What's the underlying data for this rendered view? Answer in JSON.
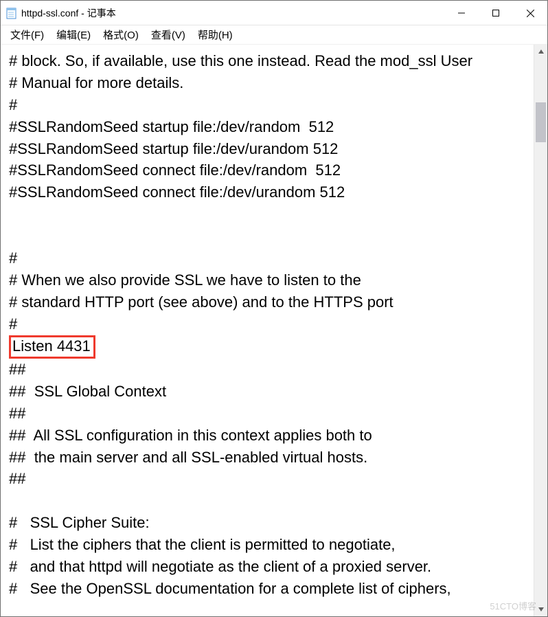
{
  "window": {
    "title": "httpd-ssl.conf - 记事本"
  },
  "menu": {
    "file": "文件(F)",
    "edit": "编辑(E)",
    "format": "格式(O)",
    "view": "查看(V)",
    "help": "帮助(H)"
  },
  "text": {
    "l1": "# block. So, if available, use this one instead. Read the mod_ssl User",
    "l2": "# Manual for more details.",
    "l3": "#",
    "l4": "#SSLRandomSeed startup file:/dev/random  512",
    "l5": "#SSLRandomSeed startup file:/dev/urandom 512",
    "l6": "#SSLRandomSeed connect file:/dev/random  512",
    "l7": "#SSLRandomSeed connect file:/dev/urandom 512",
    "l8": "",
    "l9": "",
    "l10": "#",
    "l11": "# When we also provide SSL we have to listen to the",
    "l12": "# standard HTTP port (see above) and to the HTTPS port",
    "l13": "#",
    "l14": "Listen 4431",
    "l15": "##",
    "l16": "##  SSL Global Context",
    "l17": "##",
    "l18": "##  All SSL configuration in this context applies both to",
    "l19": "##  the main server and all SSL-enabled virtual hosts.",
    "l20": "##",
    "l21": "",
    "l22": "#   SSL Cipher Suite:",
    "l23": "#   List the ciphers that the client is permitted to negotiate,",
    "l24": "#   and that httpd will negotiate as the client of a proxied server.",
    "l25": "#   See the OpenSSL documentation for a complete list of ciphers,"
  },
  "watermark": "51CTO博客"
}
